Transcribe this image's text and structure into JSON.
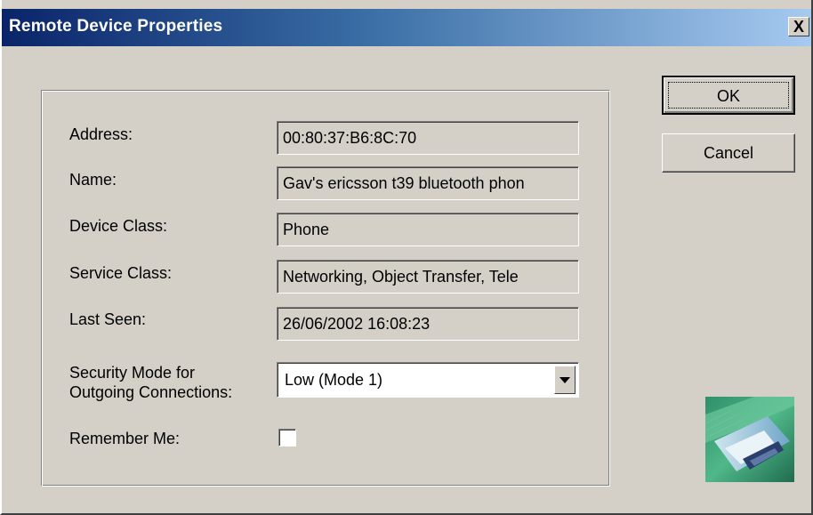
{
  "window": {
    "title": "Remote Device Properties",
    "close_label": "X"
  },
  "properties": {
    "address": {
      "label": "Address:",
      "value": "00:80:37:B6:8C:70"
    },
    "name": {
      "label": "Name:",
      "value": "Gav's ericsson t39 bluetooth phon"
    },
    "device_class": {
      "label": "Device Class:",
      "value": "Phone"
    },
    "service_class": {
      "label": "Service Class:",
      "value": "Networking, Object Transfer, Tele"
    },
    "last_seen": {
      "label": "Last Seen:",
      "value": "26/06/2002 16:08:23"
    }
  },
  "security": {
    "label_line1": "Security Mode for",
    "label_line2": "Outgoing Connections:",
    "selected": "Low (Mode 1)"
  },
  "remember": {
    "label": "Remember Me:",
    "checked": false
  },
  "buttons": {
    "ok": "OK",
    "cancel": "Cancel"
  },
  "logo": {
    "icon": "bluetooth-card-image"
  }
}
